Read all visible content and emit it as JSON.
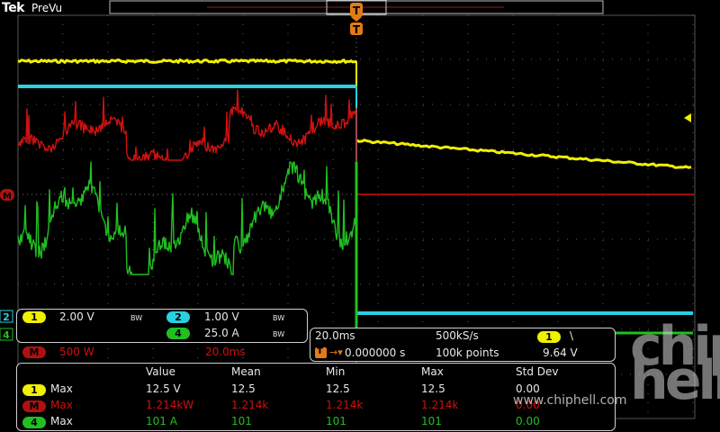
{
  "header": {
    "brand": "Tek",
    "mode": "PreVu"
  },
  "trigger_marker": "T",
  "ref_markers": {
    "math": "M",
    "ch2": "2",
    "ch4": "4"
  },
  "channel_box": {
    "ch1": {
      "badge": "1",
      "scale": "2.00 V",
      "bw": "BW"
    },
    "ch2": {
      "badge": "2",
      "scale": "1.00 V",
      "bw": "BW"
    },
    "ch4": {
      "badge": "4",
      "scale": "25.0 A",
      "bw": "BW"
    },
    "math": {
      "badge": "M",
      "scale": "500 W",
      "time": "20.0ms"
    }
  },
  "timebase_box": {
    "horizontal": "20.0ms",
    "sample_rate": "500kS/s",
    "trigger_delay": "0.000000 s",
    "record_length": "100k points",
    "trigger_source_badge": "1",
    "trigger_slope": "\\",
    "trigger_level": "9.64 V"
  },
  "measurements": {
    "columns": [
      "Value",
      "Mean",
      "Min",
      "Max",
      "Std Dev"
    ],
    "rows": [
      {
        "badge": "1",
        "label": "Max",
        "value": "12.5 V",
        "mean": "12.5",
        "min": "12.5",
        "max": "12.5",
        "std": "0.00"
      },
      {
        "badge": "M",
        "label": "Max",
        "value": "1.214kW",
        "mean": "1.214k",
        "min": "1.214k",
        "max": "1.214k",
        "std": "0.00"
      },
      {
        "badge": "4",
        "label": "Max",
        "value": "101 A",
        "mean": "101",
        "min": "101",
        "max": "101",
        "std": "0.00"
      }
    ]
  },
  "watermark": {
    "logo": "chip hell",
    "url": "www.chiphell.com"
  },
  "colors": {
    "ch1": "#f0f000",
    "ch2": "#29d0e0",
    "math": "#d01010",
    "ch4": "#20c020",
    "grid": "#5a5a5a"
  }
}
